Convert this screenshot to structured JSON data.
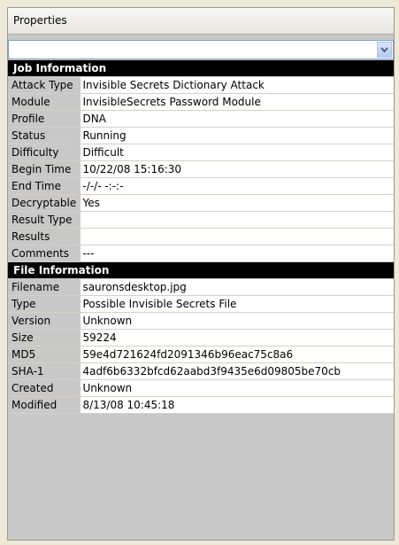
{
  "header": {
    "title": "Properties"
  },
  "combo": {
    "value": ""
  },
  "sections": [
    {
      "title": "Job Information",
      "rows": [
        {
          "label": "Attack Type",
          "value": "Invisible Secrets Dictionary Attack"
        },
        {
          "label": "Module",
          "value": "InvisibleSecrets Password Module"
        },
        {
          "label": "Profile",
          "value": "DNA"
        },
        {
          "label": "Status",
          "value": "Running"
        },
        {
          "label": "Difficulty",
          "value": "Difficult"
        },
        {
          "label": "Begin Time",
          "value": "10/22/08 15:16:30"
        },
        {
          "label": "End Time",
          "value": "-/-/- -:-:-"
        },
        {
          "label": "Decryptable",
          "value": "Yes"
        },
        {
          "label": "Result Type",
          "value": ""
        },
        {
          "label": "Results",
          "value": ""
        },
        {
          "label": "Comments",
          "value": "---"
        }
      ]
    },
    {
      "title": "File Information",
      "rows": [
        {
          "label": "Filename",
          "value": "sauronsdesktop.jpg"
        },
        {
          "label": "Type",
          "value": "Possible Invisible Secrets File"
        },
        {
          "label": "Version",
          "value": "Unknown"
        },
        {
          "label": "Size",
          "value": "59224"
        },
        {
          "label": "MD5",
          "value": "59e4d721624fd2091346b96eac75c8a6"
        },
        {
          "label": "SHA-1",
          "value": "4adf6b6332bfcd62aabd3f9435e6d09805be70cb"
        },
        {
          "label": "Created",
          "value": "Unknown"
        },
        {
          "label": "Modified",
          "value": "8/13/08 10:45:18"
        }
      ]
    }
  ]
}
